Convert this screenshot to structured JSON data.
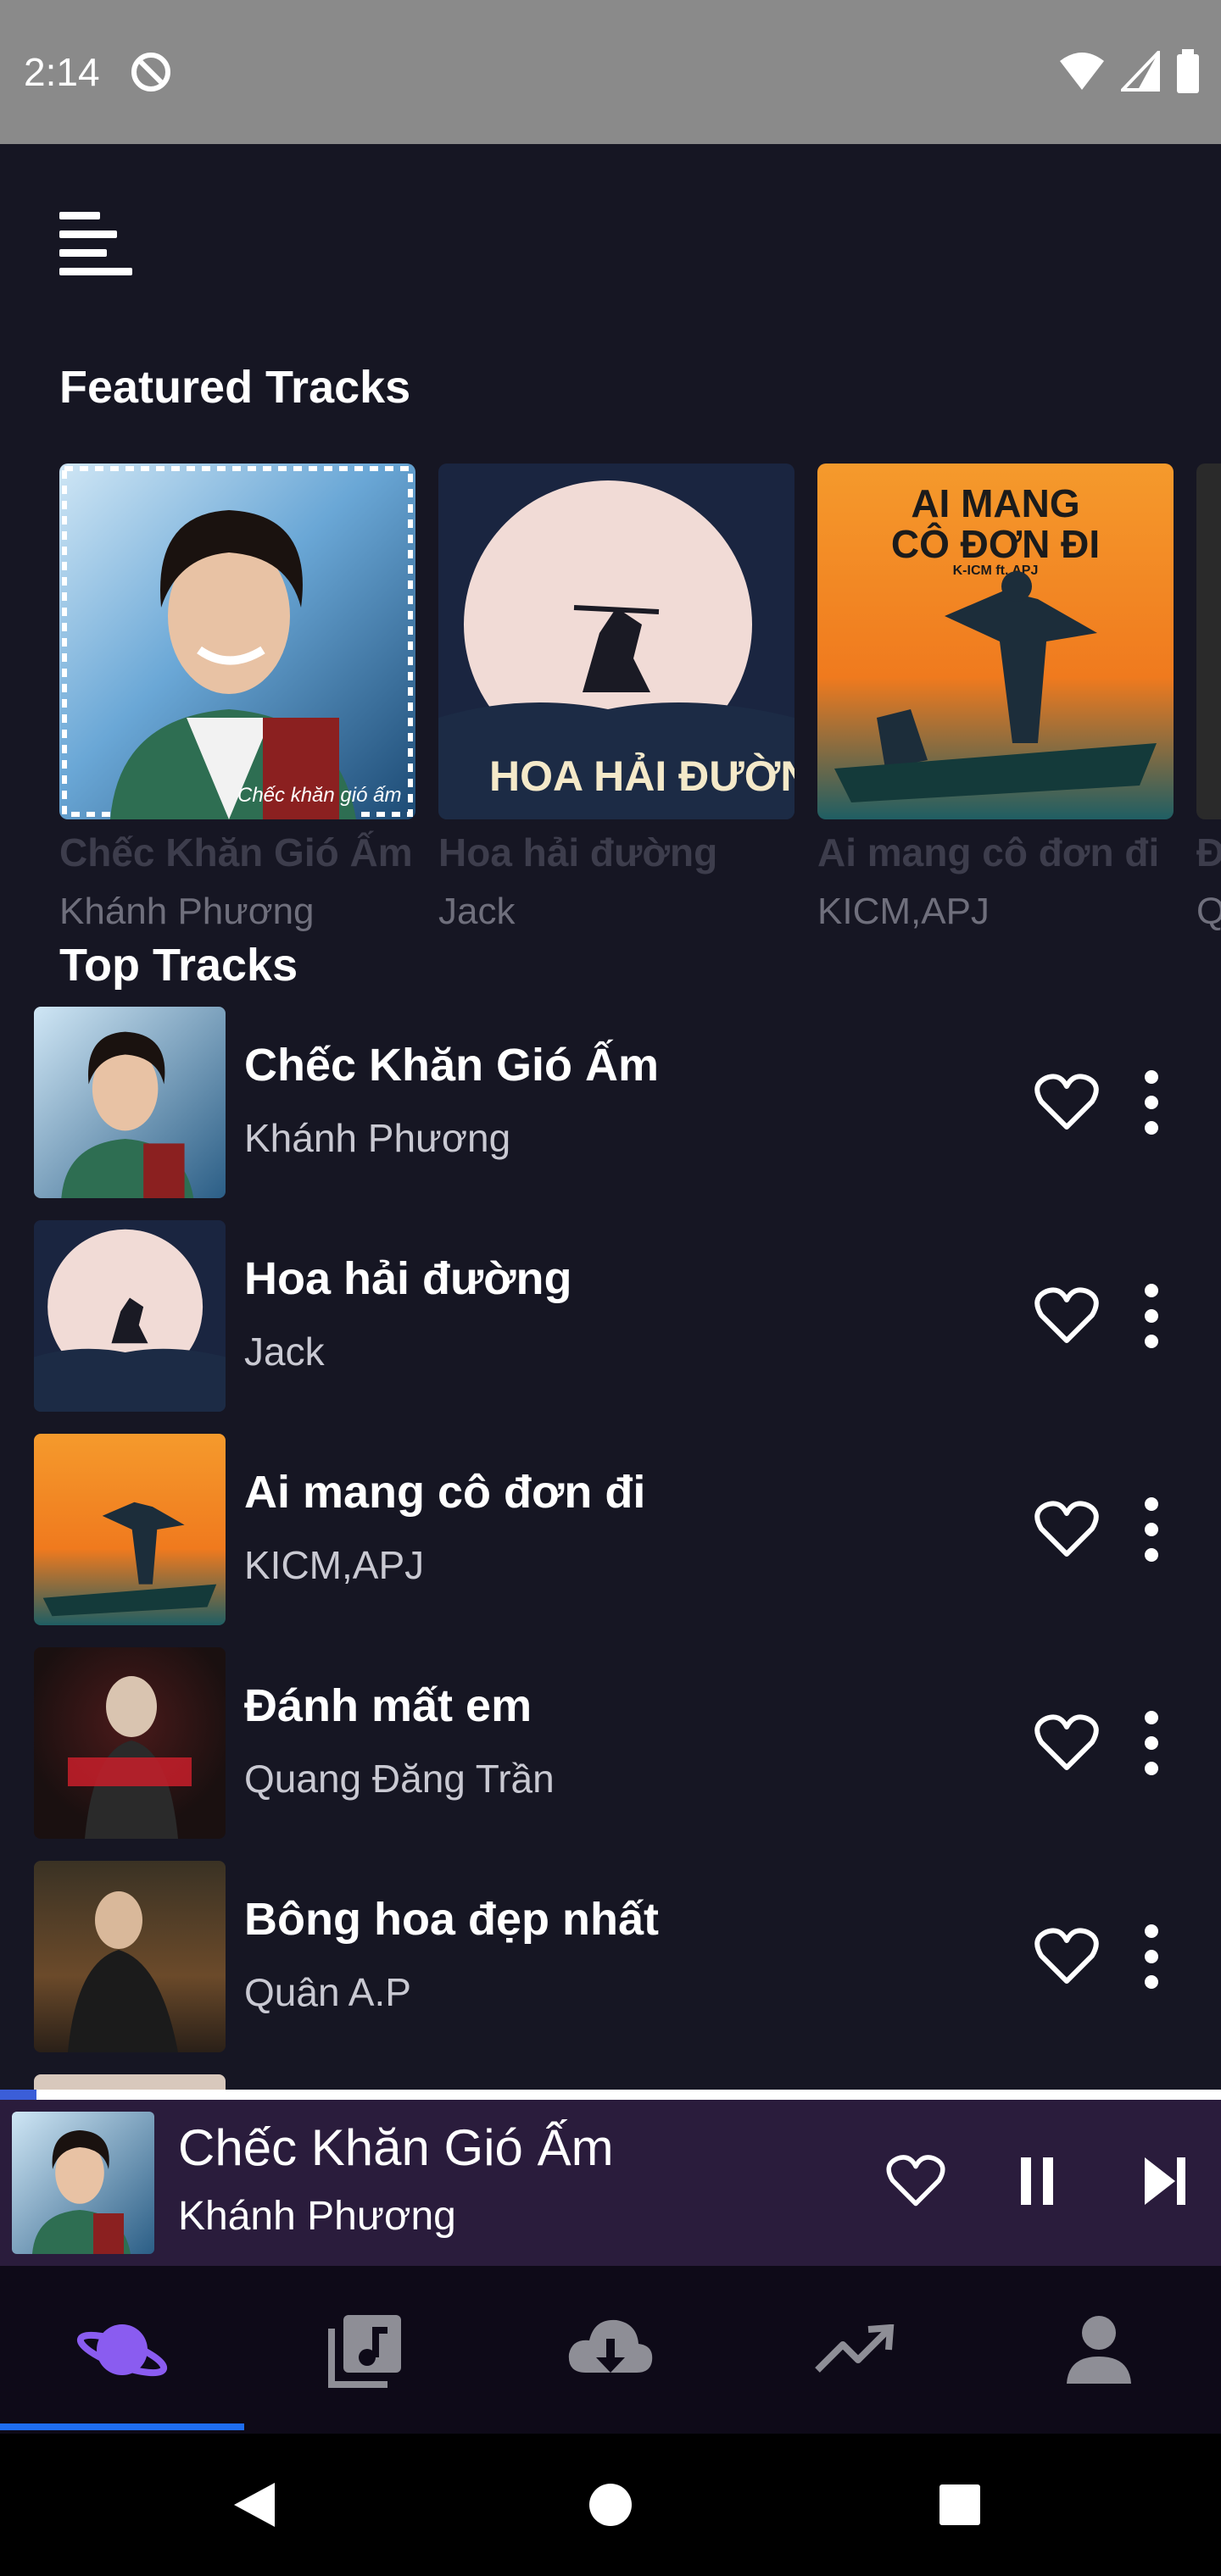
{
  "status_bar": {
    "time": "2:14"
  },
  "featured": {
    "title": "Featured Tracks",
    "cards": [
      {
        "title": "Chếc Khăn Gió Ấm",
        "artist": "Khánh Phương",
        "cover_text": "Chếc khăn gió ấm"
      },
      {
        "title": "Hoa hải đường",
        "artist": "Jack",
        "cover_text": "HOA HẢI ĐƯỜNG"
      },
      {
        "title": "Ai mang cô đơn đi",
        "artist": "KICM,APJ",
        "cover_line1": "AI MANG",
        "cover_line2": "CÔ ĐƠN ĐI",
        "cover_sub": "K-ICM ft. APJ"
      },
      {
        "title": "Đ",
        "artist": "Q"
      }
    ]
  },
  "top_tracks": {
    "title": "Top Tracks",
    "items": [
      {
        "title": "Chếc Khăn Gió Ấm",
        "artist": "Khánh Phương"
      },
      {
        "title": "Hoa hải đường",
        "artist": "Jack"
      },
      {
        "title": "Ai mang cô đơn đi",
        "artist": "KICM,APJ"
      },
      {
        "title": "Đánh mất em",
        "artist": "Quang Đăng Trần"
      },
      {
        "title": "Bông hoa đẹp nhất",
        "artist": "Quân A.P"
      }
    ]
  },
  "mini_player": {
    "title": "Chếc Khăn Gió Ấm",
    "artist": "Khánh Phương",
    "progress": 0.03
  },
  "bottom_nav": {
    "items": [
      {
        "icon": "planet-icon",
        "active": true
      },
      {
        "icon": "music-library-icon",
        "active": false
      },
      {
        "icon": "cloud-download-icon",
        "active": false
      },
      {
        "icon": "trending-icon",
        "active": false
      },
      {
        "icon": "person-icon",
        "active": false
      }
    ]
  },
  "colors": {
    "accent": "#1e6df0",
    "active_icon": "#8a5cf0",
    "inactive_icon": "#8e8e96",
    "background": "#161623"
  }
}
